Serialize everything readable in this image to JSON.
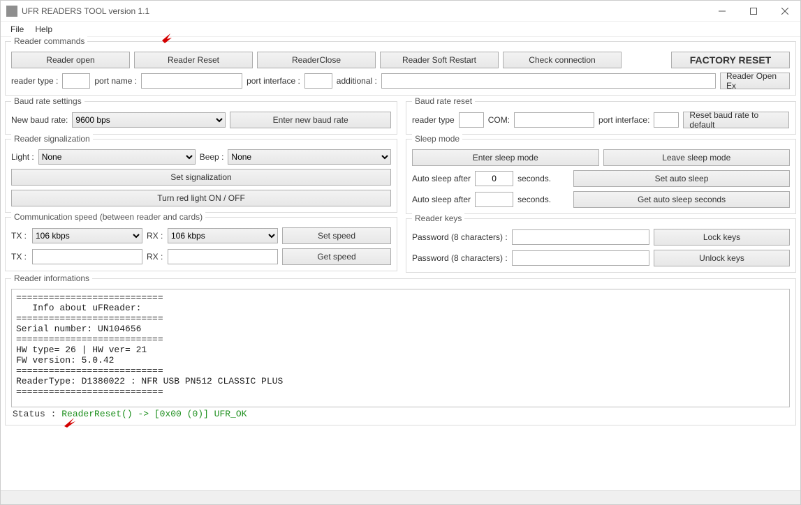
{
  "window": {
    "title": "UFR READERS TOOL version 1.1"
  },
  "menu": {
    "file": "File",
    "help": "Help"
  },
  "reader_commands": {
    "legend": "Reader commands",
    "reader_open": "Reader open",
    "reader_reset": "Reader Reset",
    "reader_close": "ReaderClose",
    "reader_soft_restart": "Reader Soft Restart",
    "check_connection": "Check connection",
    "factory_reset": "FACTORY RESET",
    "reader_type_lbl": "reader type :",
    "port_name_lbl": "port name :",
    "port_interface_lbl": "port interface :",
    "additional_lbl": "additional :",
    "reader_open_ex": "Reader Open Ex",
    "reader_type_val": "",
    "port_name_val": "",
    "port_interface_val": "",
    "additional_val": ""
  },
  "baud_rate_settings": {
    "legend": "Baud rate settings",
    "new_baud_lbl": "New baud rate:",
    "selected": "9600 bps",
    "enter_btn": "Enter new baud rate"
  },
  "baud_rate_reset": {
    "legend": "Baud rate reset",
    "reader_type_lbl": "reader type",
    "com_lbl": "COM:",
    "port_interface_lbl": "port interface:",
    "reset_btn": "Reset baud rate to default",
    "reader_type_val": "",
    "com_val": "",
    "port_interface_val": ""
  },
  "signalization": {
    "legend": "Reader signalization",
    "light_lbl": "Light :",
    "light_val": "None",
    "beep_lbl": "Beep :",
    "beep_val": "None",
    "set_btn": "Set signalization",
    "turn_red_btn": "Turn red light ON / OFF"
  },
  "sleep": {
    "legend": "Sleep mode",
    "enter_btn": "Enter sleep mode",
    "leave_btn": "Leave sleep mode",
    "auto_after_lbl": "Auto sleep after",
    "seconds_lbl": "seconds.",
    "set_auto_btn": "Set auto sleep",
    "get_auto_btn": "Get auto sleep seconds",
    "auto_val1": "0",
    "auto_val2": ""
  },
  "comm_speed": {
    "legend": "Communication speed (between reader and cards)",
    "tx_lbl": "TX :",
    "rx_lbl": "RX :",
    "tx_val": "106 kbps",
    "rx_val": "106 kbps",
    "set_btn": "Set speed",
    "get_btn": "Get speed",
    "tx_out": "",
    "rx_out": ""
  },
  "keys": {
    "legend": "Reader keys",
    "pwd_lbl": "Password (8 characters) :",
    "lock_btn": "Lock keys",
    "unlock_btn": "Unlock keys",
    "pwd1": "",
    "pwd2": ""
  },
  "reader_info": {
    "legend": "Reader informations",
    "text": "===========================\n   Info about uFReader:\n===========================\nSerial number: UN104656\n===========================\nHW type= 26 | HW ver= 21\nFW version: 5.0.42\n===========================\nReaderType: D1380022 : NFR USB PN512 CLASSIC PLUS\n===========================",
    "status_prefix": "Status  :  ",
    "status_msg": "ReaderReset() -> [0x00 (0)] UFR_OK"
  }
}
